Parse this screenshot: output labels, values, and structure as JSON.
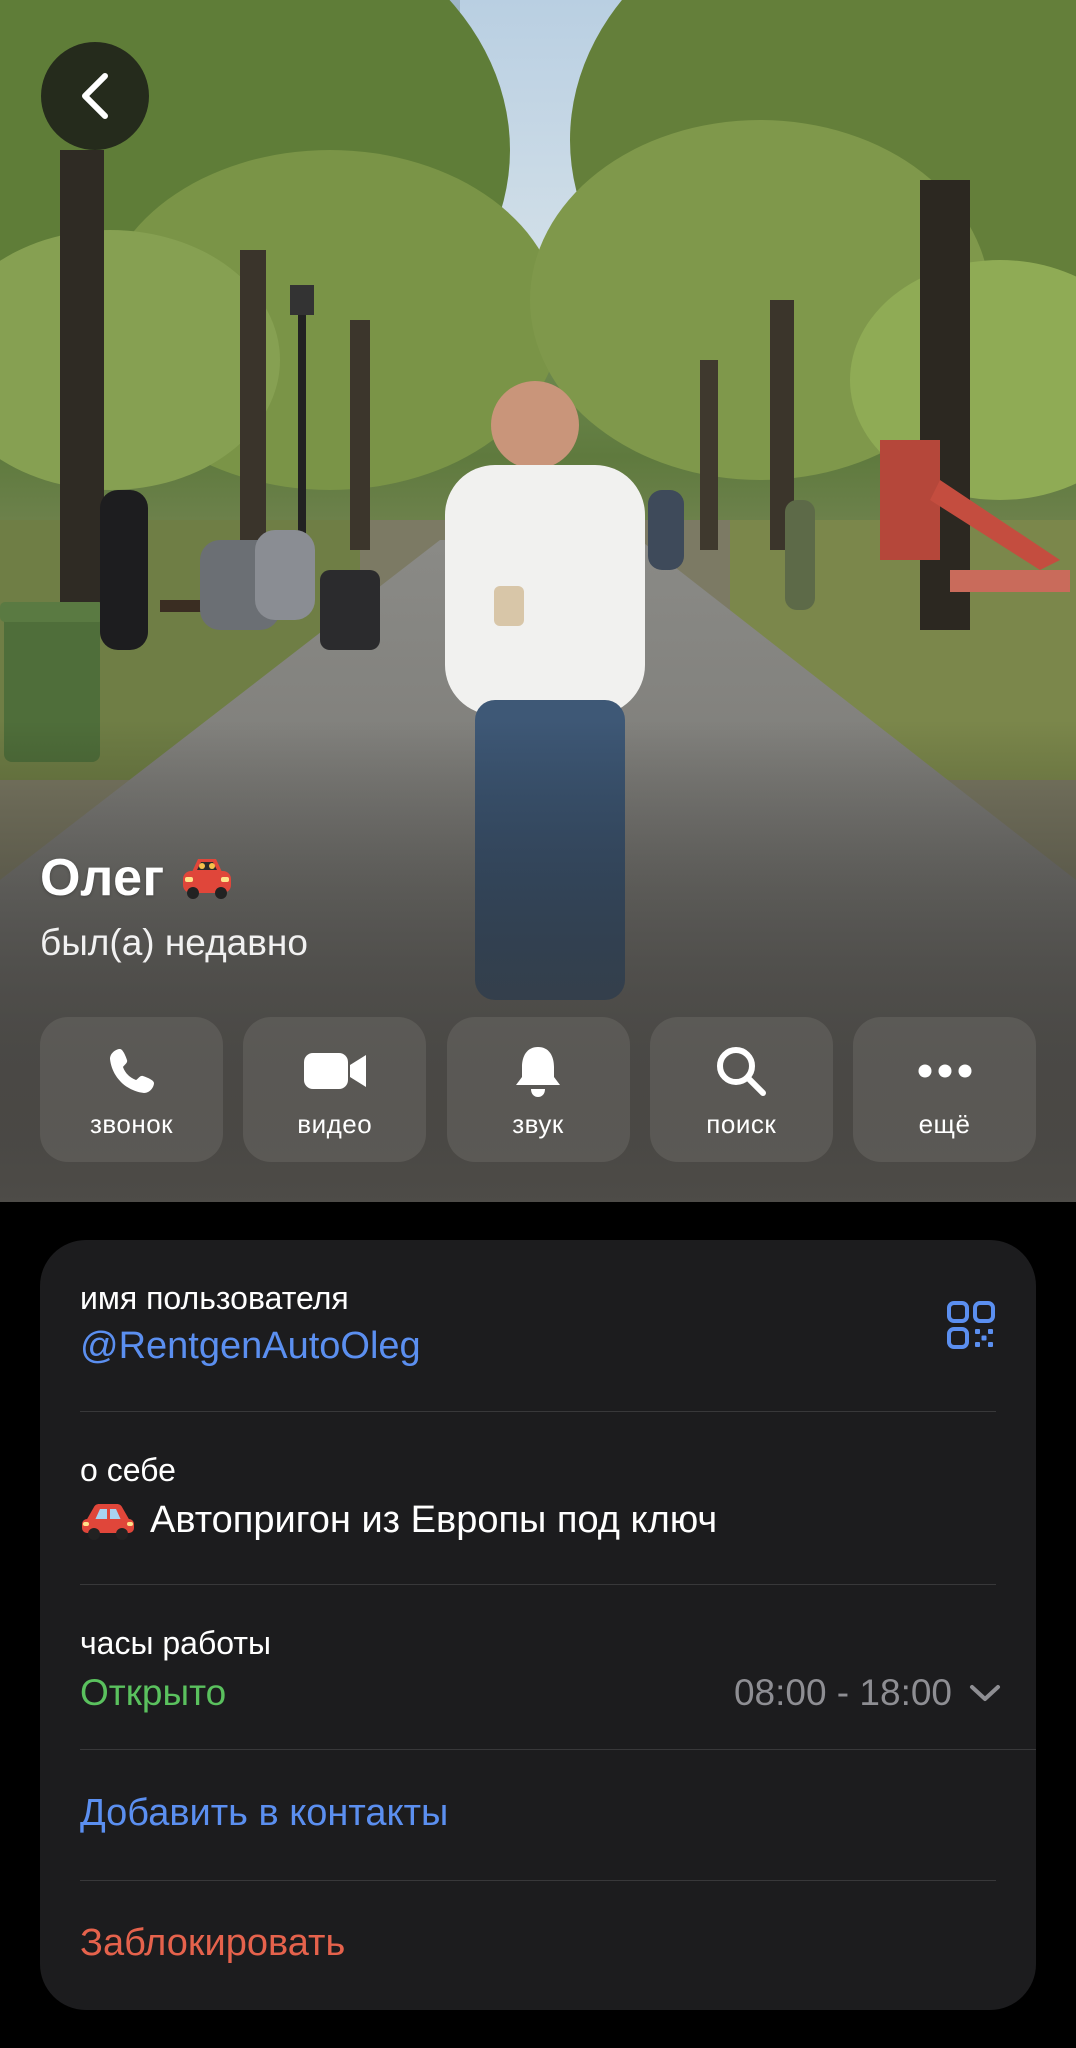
{
  "header": {
    "back_icon": "chevron-left-icon"
  },
  "profile": {
    "name": "Олег",
    "name_emoji": "car-emoji",
    "status": "был(а) недавно"
  },
  "actions": [
    {
      "id": "call",
      "label": "звонок",
      "icon": "phone-icon"
    },
    {
      "id": "video",
      "label": "видео",
      "icon": "video-camera-icon"
    },
    {
      "id": "sound",
      "label": "звук",
      "icon": "bell-icon"
    },
    {
      "id": "search",
      "label": "поиск",
      "icon": "search-icon"
    },
    {
      "id": "more",
      "label": "ещё",
      "icon": "more-dots-icon"
    }
  ],
  "info": {
    "username_label": "имя пользователя",
    "username": "@RentgenAutoOleg",
    "qr_icon": "qr-code-icon",
    "bio_label": "о себе",
    "bio_text": "Автопригон из Европы под ключ",
    "hours_label": "часы работы",
    "hours_status": "Открыто",
    "hours_range": "08:00 - 18:00",
    "add_contact": "Добавить в контакты",
    "block": "Заблокировать"
  },
  "colors": {
    "accent_blue": "#5b8ff0",
    "open_green": "#5ac15e",
    "danger_red": "#e5624c",
    "card_bg": "#1c1c1e",
    "secondary_text": "#8e8e93"
  }
}
